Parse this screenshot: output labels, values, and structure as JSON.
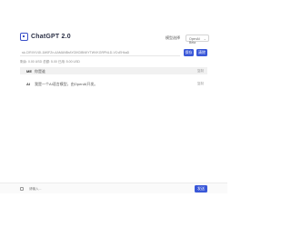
{
  "header": {
    "logo_text": "ChatGPT 2.0",
    "model_label": "模型选择",
    "model_value": "OpenAI Beta"
  },
  "key_bar": {
    "value": "sk-CIRXVVlJI-1M0FZn-4AMANBrAYGIKDBNKYTWVKGRPNLD-VCvEHkaD",
    "save_label": "保存",
    "clear_label": "清除"
  },
  "stats": "剩余: 0.00 USD   总额: 5.00   已用: 5.00 USD",
  "messages": [
    {
      "role": "ME",
      "text": "你是谁",
      "copy": "复制"
    },
    {
      "role": "AI",
      "text": "我是一个AI语言模型，由OpenAI开发。",
      "copy": "复制"
    }
  ],
  "footer": {
    "placeholder": "请输入...",
    "send_label": "发送"
  },
  "colors": {
    "accent": "#3957d8"
  }
}
